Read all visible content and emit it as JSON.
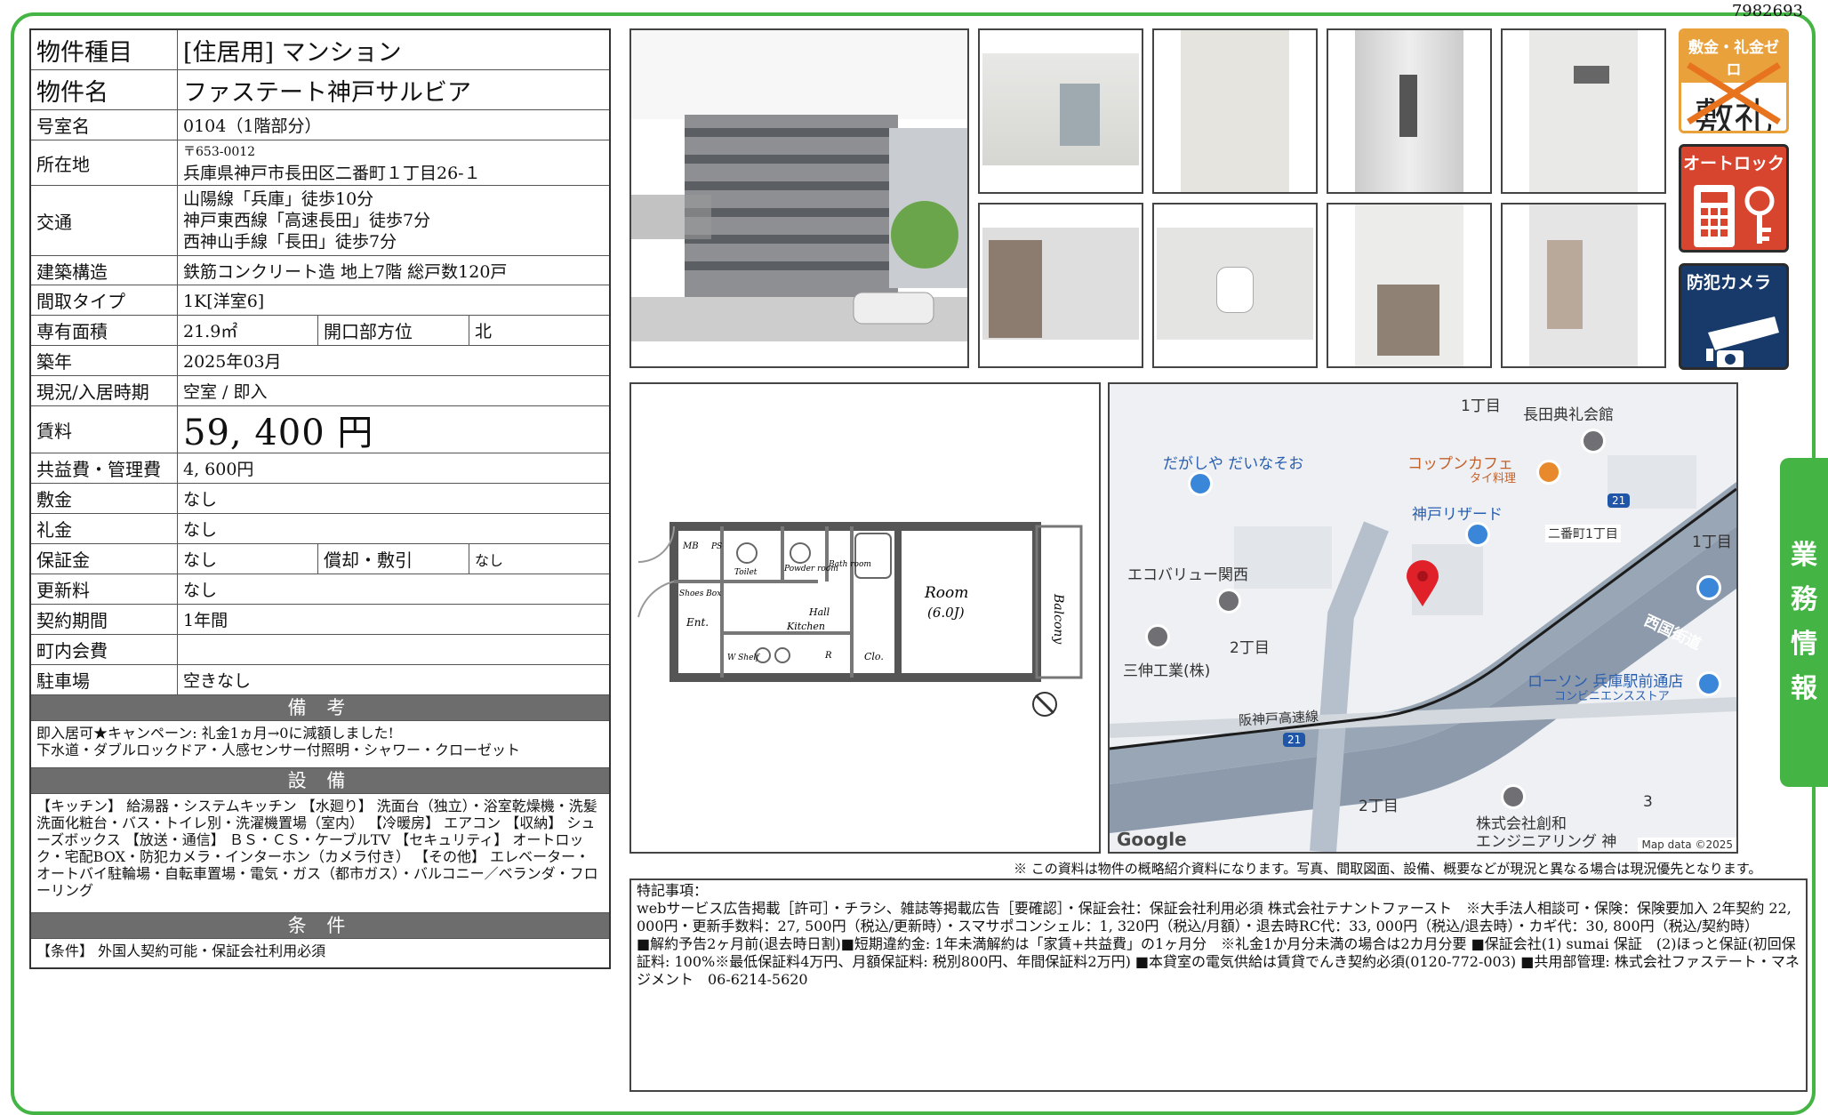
{
  "doc_id": "7982693",
  "rows": {
    "type": {
      "label": "物件種目",
      "value": "[住居用]  マンション"
    },
    "name": {
      "label": "物件名",
      "value": "ファステート神戸サルビア"
    },
    "room": {
      "label": "号室名",
      "value": "0104（1階部分）"
    },
    "address": {
      "label": "所在地",
      "postal": "〒653-0012",
      "value": "兵庫県神戸市長田区二番町１丁目26-１"
    },
    "transport": {
      "label": "交通",
      "lines": [
        "山陽線「兵庫」徒歩10分",
        "神戸東西線「高速長田」徒歩7分",
        "西神山手線「長田」徒歩7分"
      ]
    },
    "structure": {
      "label": "建築構造",
      "value": "鉄筋コンクリート造  地上7階  総戸数120戸"
    },
    "layout": {
      "label": "間取タイプ",
      "value": "1K[洋室6]"
    },
    "area": {
      "label": "専有面積",
      "value": "21.9㎡",
      "label2": "開口部方位",
      "value2": "北"
    },
    "built": {
      "label": "築年",
      "value": "2025年03月"
    },
    "status": {
      "label": "現況/入居時期",
      "value": "空室  /  即入"
    },
    "rent": {
      "label": "賃料",
      "value": "59, 400  円"
    },
    "fee": {
      "label": "共益費・管理費",
      "value": "4, 600円"
    },
    "deposit": {
      "label": "敷金",
      "value": "なし"
    },
    "key_money": {
      "label": "礼金",
      "value": "なし"
    },
    "guarantee": {
      "label": "保証金",
      "value": "なし",
      "label2": "償却・敷引",
      "value2": "なし"
    },
    "renewal": {
      "label": "更新料",
      "value": "なし"
    },
    "contract": {
      "label": "契約期間",
      "value": "1年間"
    },
    "community": {
      "label": "町内会費",
      "value": ""
    },
    "parking": {
      "label": "駐車場",
      "value": "空きなし"
    }
  },
  "remarks": {
    "title": "備  考",
    "lines": [
      "即入居可★キャンペーン: 礼金1ヵ月→0に減額しました!",
      "下水道・ダブルロックドア・人感センサー付照明・シャワー・クローゼット"
    ]
  },
  "equipment": {
    "title": "設  備",
    "text": "【キッチン】 給湯器・システムキッチン 【水廻り】 洗面台（独立）・浴室乾燥機・洗髪洗面化粧台・バス・トイレ別・洗濯機置場（室内） 【冷暖房】 エアコン 【収納】 シューズボックス 【放送・通信】 ＢＳ・ＣＳ・ケーブルTV 【セキュリティ】 オートロック・宅配BOX・防犯カメラ・インターホン（カメラ付き） 【その他】 エレベーター・オートバイ駐輪場・自転車置場・電気・ガス（都市ガス）・バルコニー／ベランダ・フローリング"
  },
  "conditions": {
    "title": "条  件",
    "text": "【条件】 外国人契約可能・保証会社利用必須"
  },
  "badges": {
    "zero": "敷金・礼金ゼロ",
    "zero_chars": "敷礼",
    "autolock": "オートロック",
    "camera": "防犯カメラ"
  },
  "plan_labels": {
    "room": "Room",
    "room_size": "(6.0J)",
    "balcony": "Balcony",
    "mb": "MB",
    "ps": "PS",
    "toilet": "Toilet",
    "powder": "Powder room",
    "bath": "Bath room",
    "shoes": "Shoes Box",
    "ent": "Ent.",
    "hall": "Hall",
    "kitchen": "Kitchen",
    "wr": "W Shelf",
    "r": "R",
    "clo": "Clo."
  },
  "map": {
    "labels": [
      "1丁目",
      "長田典礼会館",
      "だがしや だいなそお",
      "コップンカフェ",
      "タイ料理",
      "神戸リザード",
      "二番町1丁目",
      "1丁目",
      "エコバリュー関西",
      "2丁目",
      "三伸工業(株)",
      "西国街道",
      "ローソン 兵庫駅前通店",
      "コンビニエンスストア",
      "阪神戸高速線",
      "2丁目",
      "株式会社創和",
      "エンジニアリング 神",
      "3"
    ],
    "route1": "21",
    "route2": "21",
    "footer": "Map data ©2025",
    "google": "Google"
  },
  "note": "※ この資料は物件の概略紹介資料になります。写真、間取図面、設備、概要などが現況と異なる場合は現況優先となります。",
  "special": {
    "title": "特記事項：",
    "lines": [
      "webサービス広告掲載［許可］・チラシ、雑誌等掲載広告［要確認］・保証会社：保証会社利用必須 株式会社テナントファースト　※大手法人相談可・保険：保険要加入 2年契約 22, 000円・更新手数料：27, 500円（税込/更新時）・スマサポコンシェル：1, 320円（税込/月額）・退去時RC代：33, 000円（税込/退去時）・カギ代：30, 800円（税込/契約時）",
      "■解約予告2ヶ月前(退去時日割)■短期違約金: 1年未満解約は「家賃+共益費」の1ヶ月分　※礼金1か月分未満の場合は2カ月分要 ■保証会社(1) sumai 保証　(2)ほっと保証(初回保証料: 100%※最低保証料4万円、月額保証料: 税別800円、年間保証料2万円) ■本貸室の電気供給は賃貸でんき契約必須(0120-772-003) ■共用部管理: 株式会社ファステート・マネジメント　06-6214-5620"
    ]
  },
  "side_tab": [
    "業",
    "務",
    "情",
    "報"
  ],
  "colors": {
    "frame": "#44b544",
    "section": "#6d6d6d",
    "badge_zero": "#e8a13b",
    "badge_lock": "#d8452f",
    "badge_camera": "#173a6b"
  }
}
